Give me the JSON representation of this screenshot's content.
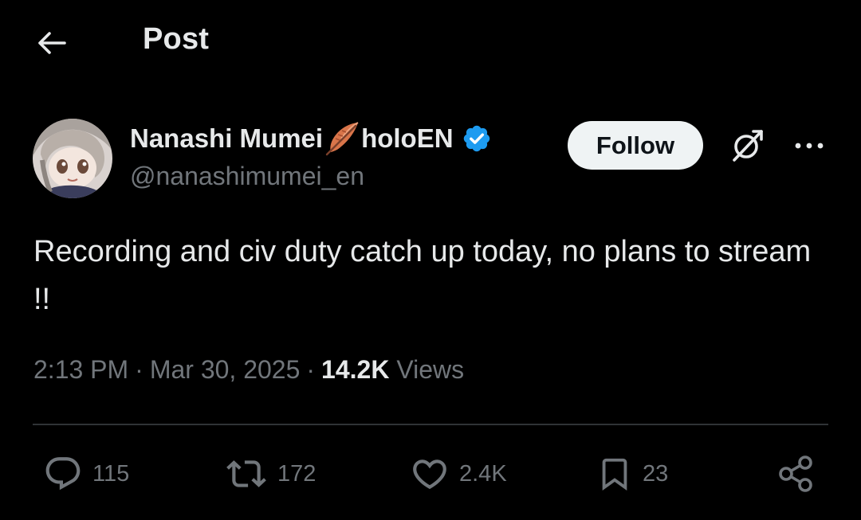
{
  "header": {
    "title": "Post",
    "back_icon": "arrow-left-icon"
  },
  "author": {
    "display_name": "Nanashi Mumei",
    "name_suffix": "holoEN",
    "emoji": "feather-icon",
    "verified_icon": "verified-badge-icon",
    "handle": "@nanashimumei_en"
  },
  "follow_button": {
    "label": "Follow"
  },
  "grok_icon": "grok-icon",
  "more_icon": "more-horizontal-icon",
  "tweet": {
    "text": "Recording and civ duty catch up today, no plans to stream !!"
  },
  "meta": {
    "time": "2:13 PM",
    "separator": "·",
    "date": "Mar 30, 2025",
    "views_count": "14.2K",
    "views_label": "Views"
  },
  "actions": {
    "reply_count": "115",
    "repost_count": "172",
    "like_count": "2.4K",
    "bookmark_count": "23"
  },
  "colors": {
    "background": "#000000",
    "text_primary": "#e7e9ea",
    "text_secondary": "#71767b",
    "verified": "#1d9bf0",
    "divider": "#2f3336",
    "follow_bg": "#eff3f4"
  }
}
